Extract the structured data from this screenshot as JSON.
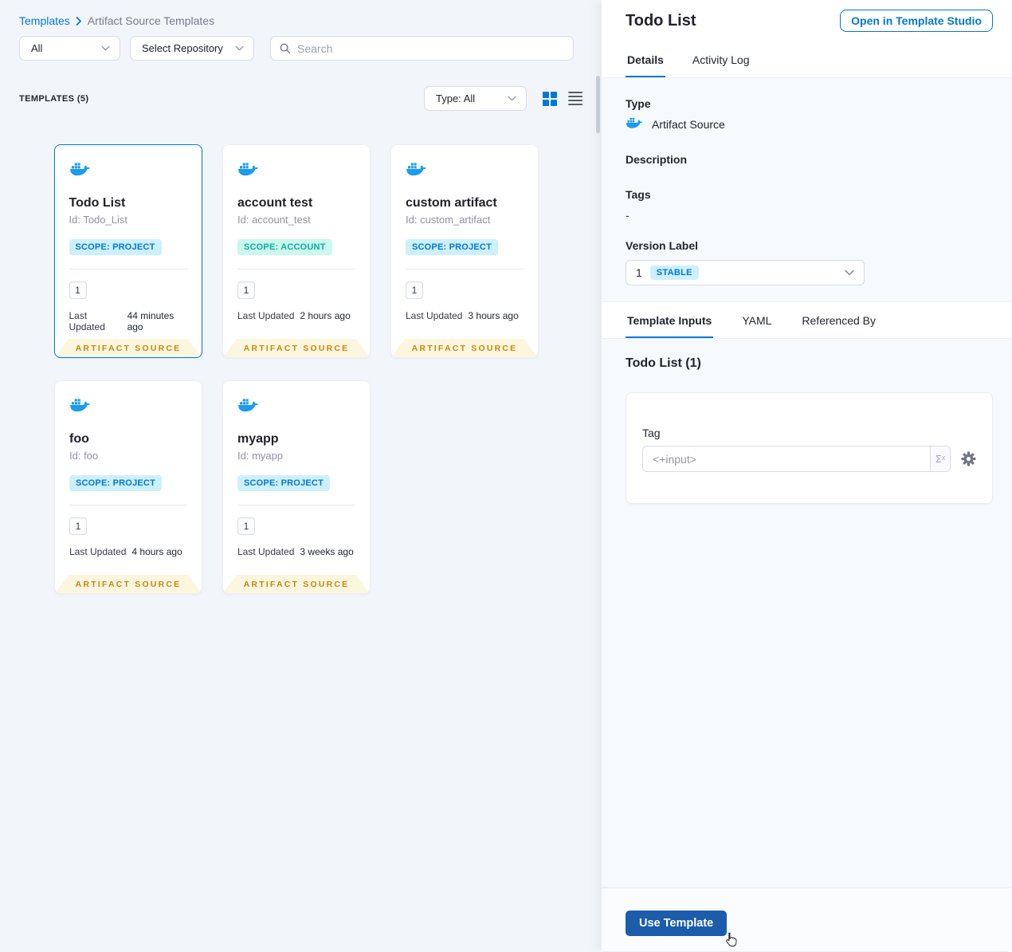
{
  "breadcrumb": {
    "root": "Templates",
    "current": "Artifact Source Templates"
  },
  "filters": {
    "scope_dropdown": "All",
    "repo_dropdown": "Select Repository",
    "search_placeholder": "Search"
  },
  "templates_section": {
    "heading": "TEMPLATES (5)",
    "type_filter": "Type: All"
  },
  "cards": [
    {
      "title": "Todo List",
      "id": "Id: Todo_List",
      "scope": "SCOPE: PROJECT",
      "scope_type": "project",
      "version": "1",
      "updated_label": "Last Updated",
      "updated_value": "44 minutes ago",
      "ribbon": "ARTIFACT SOURCE",
      "selected": true
    },
    {
      "title": "account test",
      "id": "Id: account_test",
      "scope": "SCOPE: ACCOUNT",
      "scope_type": "account",
      "version": "1",
      "updated_label": "Last Updated",
      "updated_value": "2 hours ago",
      "ribbon": "ARTIFACT SOURCE",
      "selected": false
    },
    {
      "title": "custom artifact",
      "id": "Id: custom_artifact",
      "scope": "SCOPE: PROJECT",
      "scope_type": "project",
      "version": "1",
      "updated_label": "Last Updated",
      "updated_value": "3 hours ago",
      "ribbon": "ARTIFACT SOURCE",
      "selected": false
    },
    {
      "title": "foo",
      "id": "Id: foo",
      "scope": "SCOPE: PROJECT",
      "scope_type": "project",
      "version": "1",
      "updated_label": "Last Updated",
      "updated_value": "4 hours ago",
      "ribbon": "ARTIFACT SOURCE",
      "selected": false
    },
    {
      "title": "myapp",
      "id": "Id: myapp",
      "scope": "SCOPE: PROJECT",
      "scope_type": "project",
      "version": "1",
      "updated_label": "Last Updated",
      "updated_value": "3 weeks ago",
      "ribbon": "ARTIFACT SOURCE",
      "selected": false
    }
  ],
  "panel": {
    "title": "Todo List",
    "open_studio_button": "Open in Template Studio",
    "tabs": [
      {
        "label": "Details"
      },
      {
        "label": "Activity Log"
      }
    ],
    "details": {
      "type_label": "Type",
      "type_value": "Artifact Source",
      "description_label": "Description",
      "tags_label": "Tags",
      "tags_value": "-",
      "version_label": "Version Label",
      "version_value": "1",
      "version_badge": "STABLE"
    },
    "inputs_tabs": [
      {
        "label": "Template Inputs"
      },
      {
        "label": "YAML"
      },
      {
        "label": "Referenced By"
      }
    ],
    "inputs": {
      "heading": "Todo List (1)",
      "tag_label": "Tag",
      "tag_value": "<+input>",
      "expression_icon": "Σˣ"
    },
    "use_template_button": "Use Template"
  },
  "colors": {
    "accent": "#0278d5",
    "docker_blue": "#1c9ceb",
    "primary_button": "#1c5cab",
    "ribbon_text": "#c8860d",
    "ribbon_bg": "#fdf6df",
    "project_badge_bg": "#cdf0fe",
    "account_badge_text": "#0ab1a0",
    "account_badge_bg": "#cbf7ee"
  }
}
